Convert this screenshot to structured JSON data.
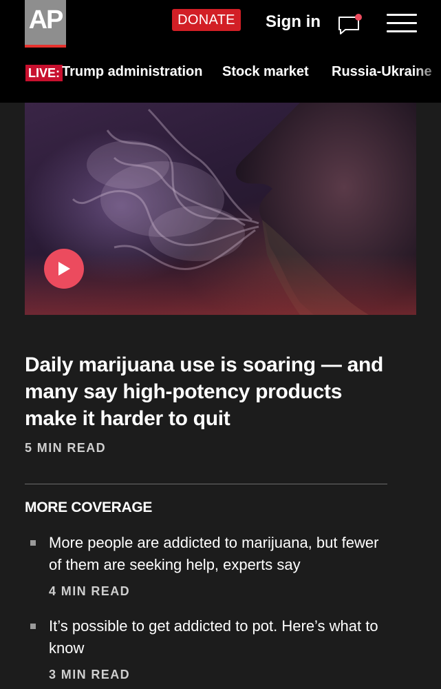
{
  "header": {
    "logo_text": "AP",
    "donate_label": "DONATE",
    "signin_label": "Sign in",
    "icons": [
      "chat-bubble-icon",
      "hamburger-menu-icon"
    ]
  },
  "nav": {
    "live_badge": "LIVE:",
    "items": [
      "Trump administration",
      "Stock market",
      "Russia-Ukraine"
    ]
  },
  "hero": {
    "play_icon": "play-icon"
  },
  "story": {
    "headline": "Daily marijuana use is soaring — and many say high-potency products make it harder to quit",
    "read_time": "5 MIN READ"
  },
  "more_coverage": {
    "label": "MORE COVERAGE",
    "items": [
      {
        "title": "More people are addicted to marijuana, but fewer of them are seeking help, experts say",
        "read_time": "4 MIN READ"
      },
      {
        "title": "It’s possible to get addicted to pot. Here’s what to know",
        "read_time": "3 MIN READ"
      }
    ]
  },
  "colors": {
    "accent_red": "#d21f26",
    "play_button": "#ec4b5e",
    "background": "#1c1c1c"
  }
}
